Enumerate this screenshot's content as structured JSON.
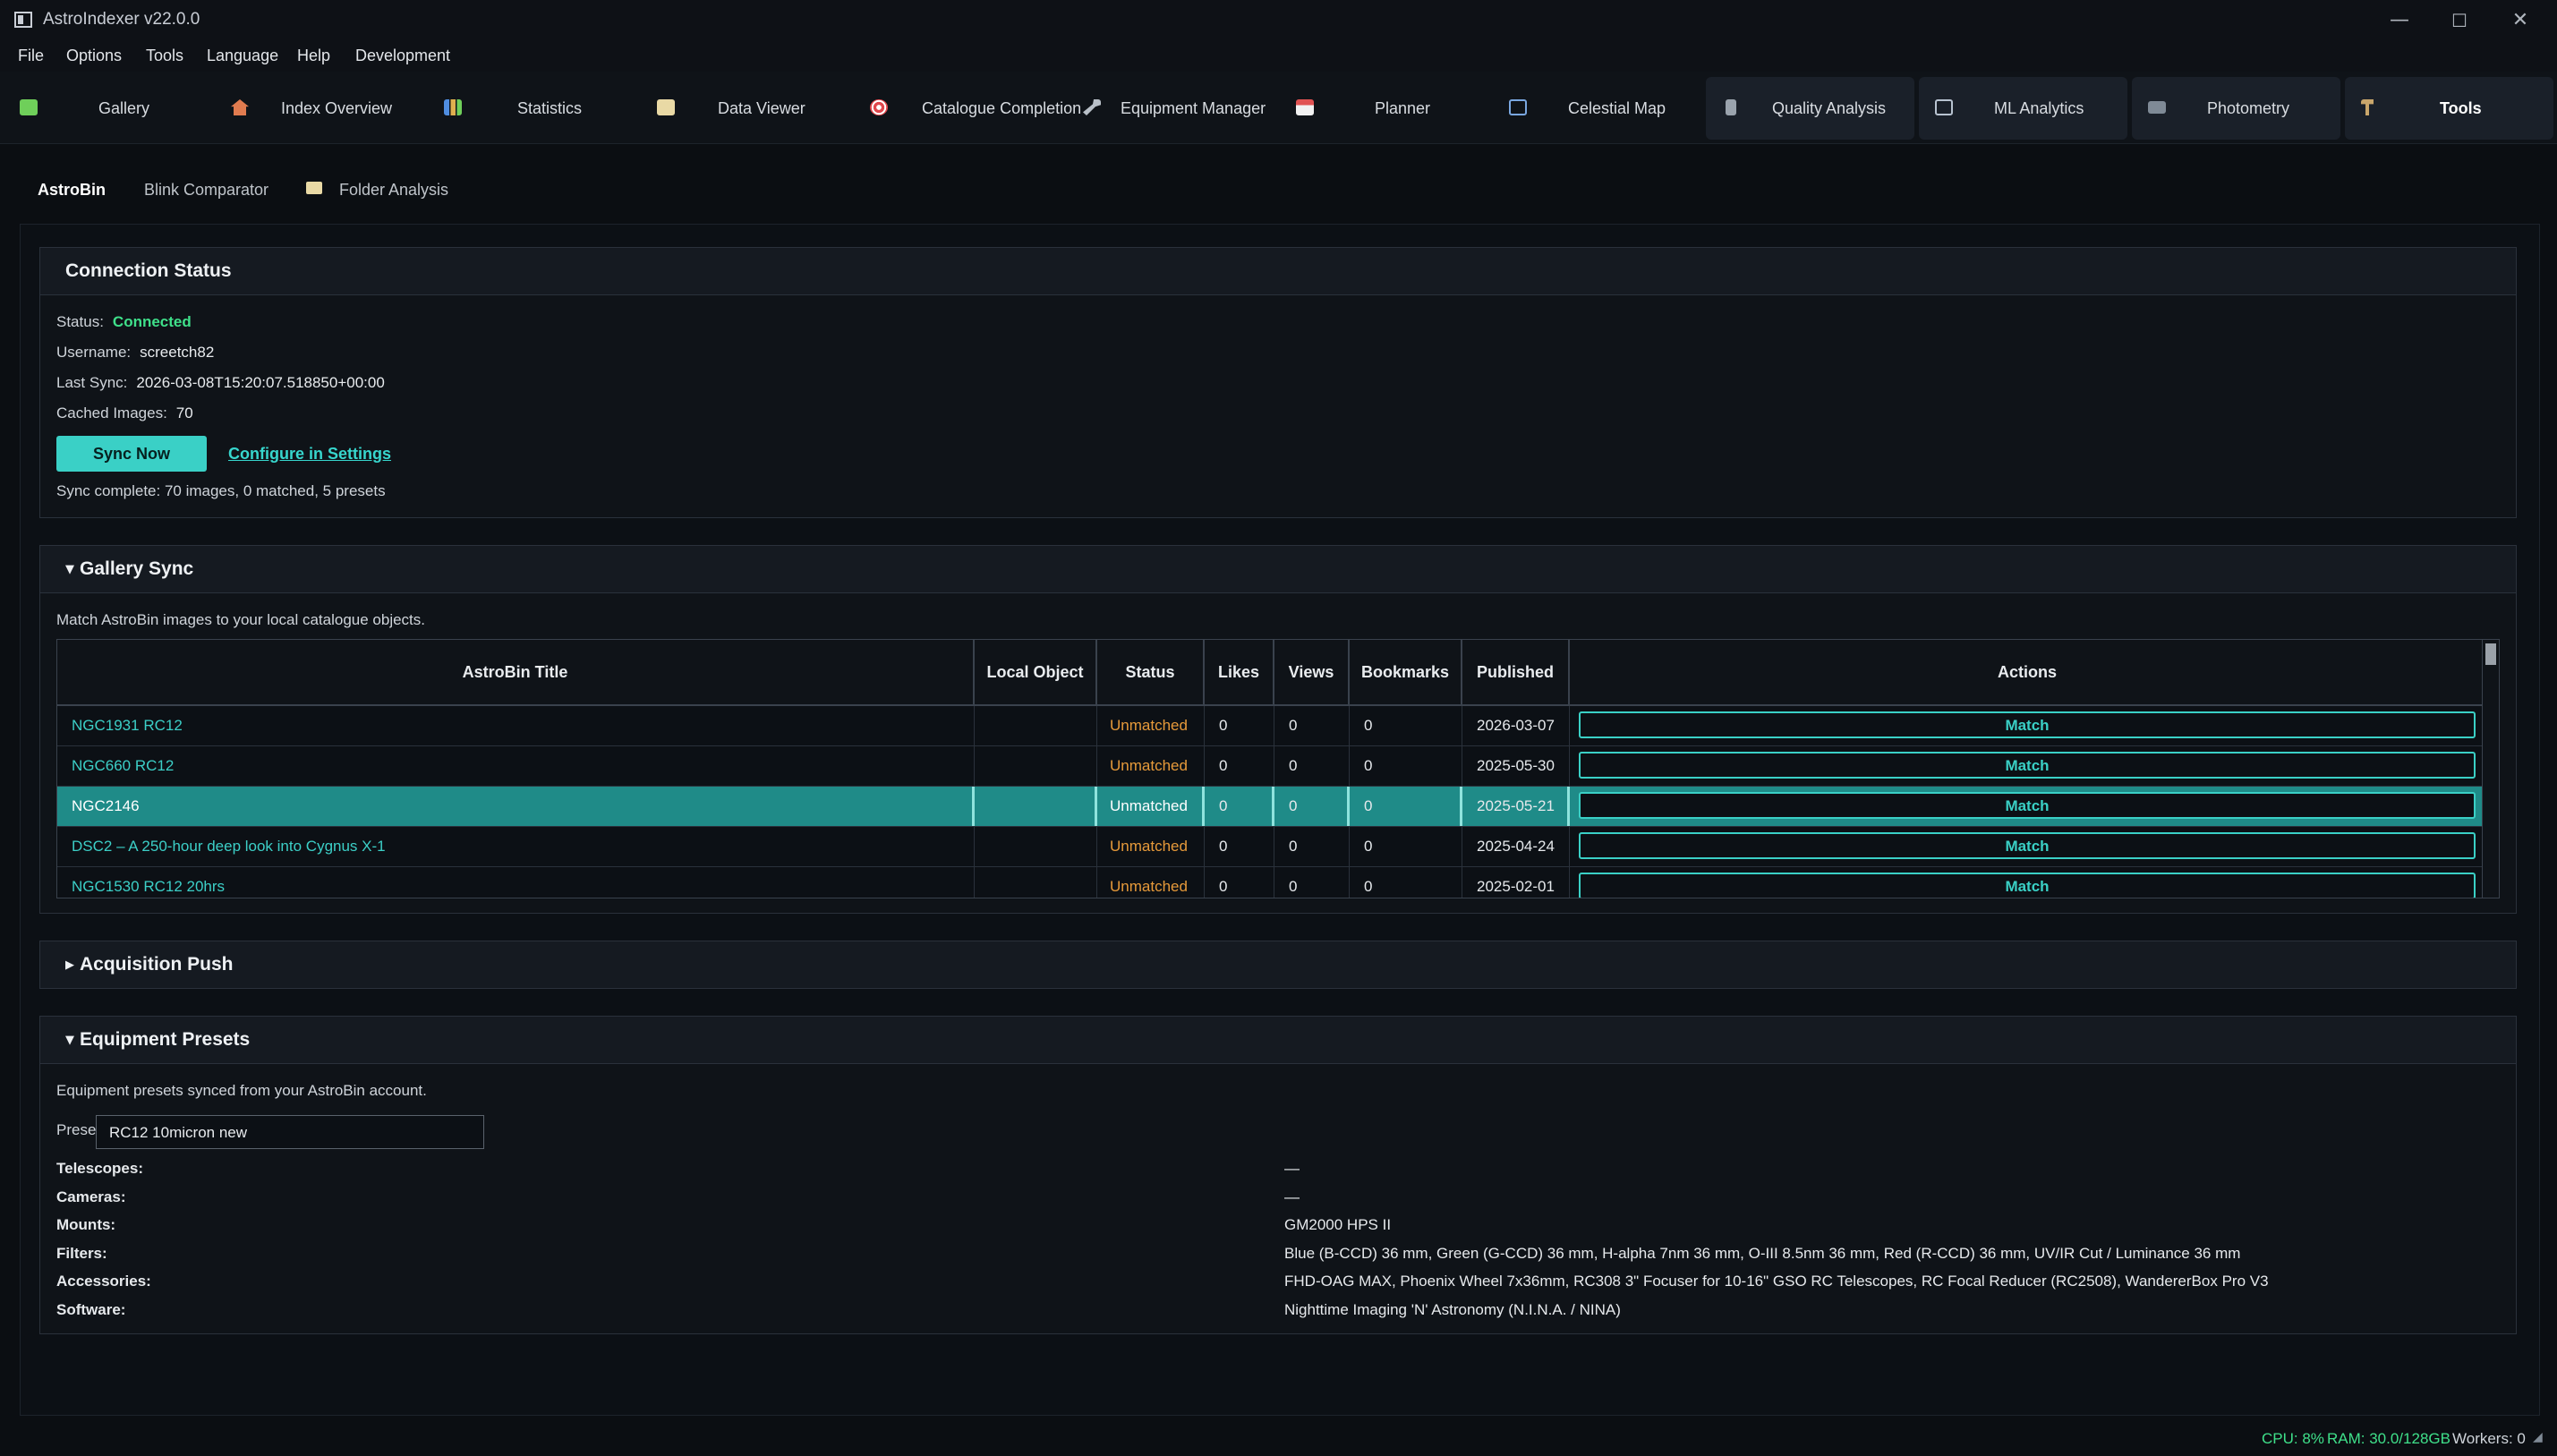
{
  "window": {
    "title": "AstroIndexer v22.0.0",
    "min_glyph": "—",
    "max_glyph": "☐",
    "close_glyph": "✕"
  },
  "menu": [
    "File",
    "Options",
    "Tools",
    "Language",
    "Help",
    "Development"
  ],
  "tabs": [
    {
      "label": "Gallery",
      "icon": "gallery-icon",
      "color": "#6fcf5a"
    },
    {
      "label": "Index  Overview",
      "icon": "home-icon",
      "color": "#e07b4f"
    },
    {
      "label": "Statistics",
      "icon": "bar-chart-icon",
      "color": "#8ab4e6"
    },
    {
      "label": "Data Viewer",
      "icon": "clipboard-icon",
      "color": "#e9d9a5"
    },
    {
      "label": "Catalogue Completion",
      "icon": "target-icon",
      "color": "#e0474c"
    },
    {
      "label": "Equipment Manager",
      "icon": "wrench-icon",
      "color": "#b9c0c8"
    },
    {
      "label": "Planner",
      "icon": "calendar-icon",
      "color": "#e05252"
    },
    {
      "label": "Celestial Map",
      "icon": "map-chart-icon",
      "color": "#7aa7e0"
    },
    {
      "label": "Quality Analysis",
      "icon": "microscope-icon",
      "color": "#9aa3ad"
    },
    {
      "label": "ML Analytics",
      "icon": "line-chart-icon",
      "color": "#b8c3d0"
    },
    {
      "label": "Photometry",
      "icon": "camera-icon",
      "color": "#7f8a96"
    },
    {
      "label": "Tools",
      "icon": "hammer-icon",
      "color": "#c9a66b"
    }
  ],
  "subtabs": [
    "AstroBin",
    "Blink Comparator",
    "Folder Analysis"
  ],
  "connection": {
    "title": "Connection Status",
    "status_label": "Status:",
    "status_value": "Connected",
    "username_label": "Username:",
    "username_value": "screetch82",
    "last_sync_label": "Last Sync:",
    "last_sync_value": "2026-03-08T15:20:07.518850+00:00",
    "cached_label": "Cached Images:",
    "cached_value": "70",
    "sync_button": "Sync Now",
    "configure_link": "Configure in Settings",
    "message": "Sync complete: 70 images, 0 matched, 5 presets"
  },
  "gallery_sync": {
    "title": "Gallery Sync",
    "description": "Match AstroBin images to your local catalogue objects.",
    "columns": [
      "AstroBin Title",
      "Local Object",
      "Status",
      "Likes",
      "Views",
      "Bookmarks",
      "Published",
      "Actions"
    ],
    "rows": [
      {
        "title": "NGC1931 RC12",
        "local": "",
        "status": "Unmatched",
        "likes": "0",
        "views": "0",
        "bookmarks": "0",
        "published": "2026-03-07",
        "action": "Match"
      },
      {
        "title": "NGC660 RC12",
        "local": "",
        "status": "Unmatched",
        "likes": "0",
        "views": "0",
        "bookmarks": "0",
        "published": "2025-05-30",
        "action": "Match"
      },
      {
        "title": "NGC2146",
        "local": "",
        "status": "Unmatched",
        "likes": "0",
        "views": "0",
        "bookmarks": "0",
        "published": "2025-05-21",
        "action": "Match"
      },
      {
        "title": "DSC2 – A 250-hour deep look into Cygnus X-1",
        "local": "",
        "status": "Unmatched",
        "likes": "0",
        "views": "0",
        "bookmarks": "0",
        "published": "2025-04-24",
        "action": "Match"
      },
      {
        "title": "NGC1530 RC12 20hrs",
        "local": "",
        "status": "Unmatched",
        "likes": "0",
        "views": "0",
        "bookmarks": "0",
        "published": "2025-02-01",
        "action": "Match"
      }
    ]
  },
  "acquisition_push": {
    "title": "Acquisition Push"
  },
  "equipment_presets": {
    "title": "Equipment Presets",
    "description": "Equipment presets synced from your AstroBin account.",
    "preset_label": "Preset:",
    "preset_value": "RC12 10micron new",
    "items": [
      {
        "label": "Telescopes:",
        "value": "—"
      },
      {
        "label": "Cameras:",
        "value": "—"
      },
      {
        "label": "Mounts:",
        "value": "GM2000 HPS II"
      },
      {
        "label": "Filters:",
        "value": "Blue (B-CCD) 36 mm, Green (G-CCD) 36 mm, H-alpha 7nm 36 mm, O-III 8.5nm 36 mm, Red (R-CCD) 36 mm, UV/IR Cut / Luminance 36 mm"
      },
      {
        "label": "Accessories:",
        "value": "FHD-OAG MAX, Phoenix Wheel 7x36mm, RC308 3\" Focuser for 10-16\" GSO RC Telescopes, RC Focal Reducer (RC2508), WandererBox Pro V3"
      },
      {
        "label": "Software:",
        "value": "Nighttime Imaging 'N' Astronomy (N.I.N.A. / NINA)"
      }
    ]
  },
  "statusbar": {
    "cpu": "CPU: 8%",
    "ram": "RAM: 30.0/128GB",
    "workers": "Workers: 0"
  },
  "colors": {
    "accent": "#3ad0c6",
    "connected": "#3fe08a",
    "unmatched": "#e79a3a",
    "selected_row": "#1f8b88"
  }
}
